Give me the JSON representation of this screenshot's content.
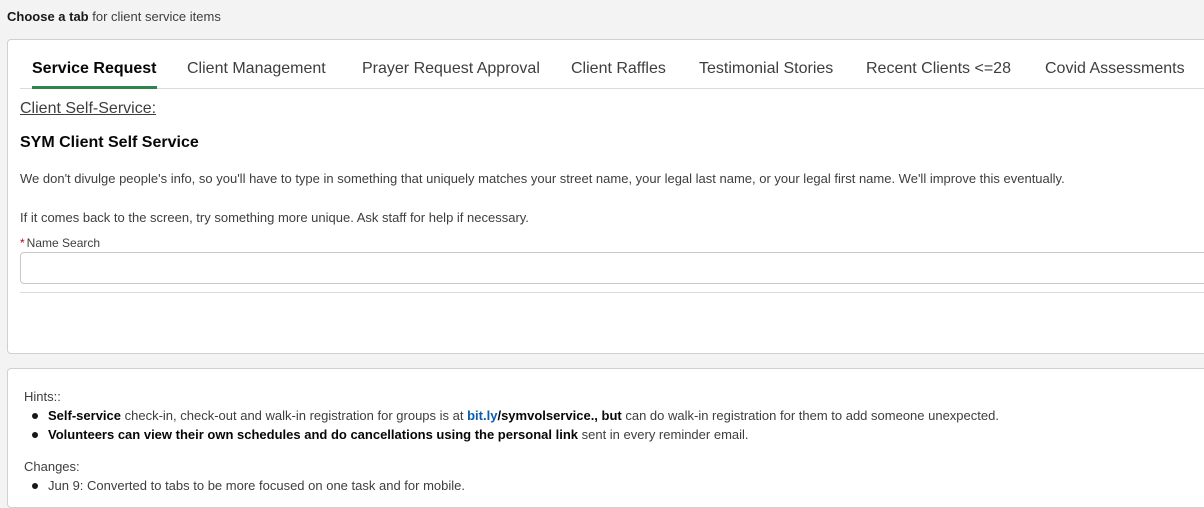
{
  "header": {
    "intro_bold": "Choose a tab",
    "intro_rest": " for client service items"
  },
  "tabs": [
    {
      "label": "Service Request",
      "active": true
    },
    {
      "label": "Client Management"
    },
    {
      "label": "Prayer Request Approval"
    },
    {
      "label": "Client Raffles"
    },
    {
      "label": "Testimonial Stories"
    },
    {
      "label": "Recent Clients <=28"
    },
    {
      "label": "Covid Assessments"
    }
  ],
  "panel": {
    "section_link": "Client Self-Service:",
    "heading": "SYM Client Self Service",
    "para1": "We don't divulge people's info, so you'll have to type in something that uniquely matches your street name, your legal last name, or your legal first name. We'll improve this eventually.",
    "para2": "If it comes back to the screen, try something more unique. Ask staff for help if necessary.",
    "required_mark": "*",
    "field_label": "Name Search",
    "field_value": ""
  },
  "hints": {
    "title": "Hints::",
    "b1_bold": "Self-service",
    "b1_text1": " check-in, check-out and walk-in registration for groups is at ",
    "b1_link": "bit.ly",
    "b1_bold2": "/symvolservice., but",
    "b1_text2": " can do walk-in registration for them to add someone unexpected.",
    "b2_bold": "Volunteers can view their own schedules and do cancellations using the personal link",
    "b2_text": " sent in every reminder email.",
    "changes_title": "Changes:",
    "c1": "Jun 9: Converted to tabs to be more focused on one task and for mobile."
  },
  "colors": {
    "active_tab_underline": "#2e844a",
    "link": "#0b5cab",
    "required": "#ba0517"
  }
}
